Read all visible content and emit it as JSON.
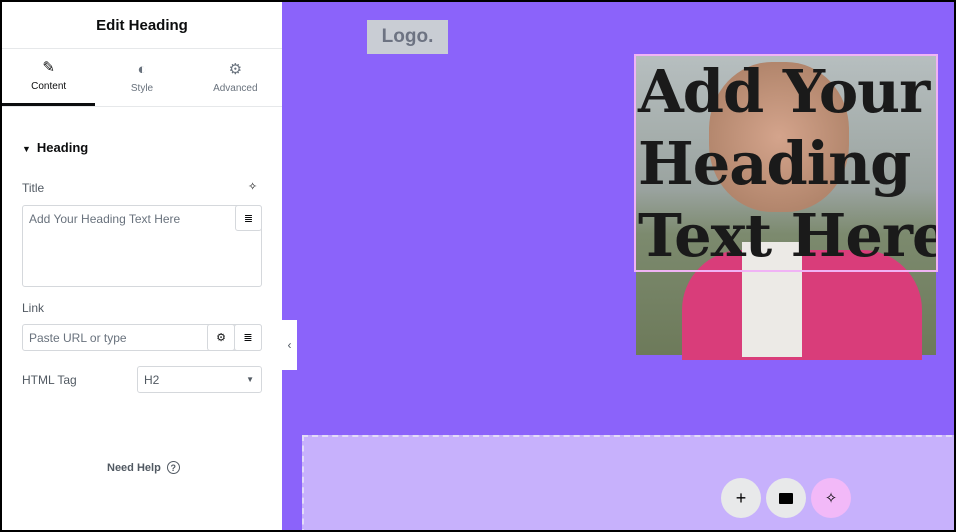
{
  "panel": {
    "title": "Edit Heading",
    "tabs": [
      {
        "label": "Content",
        "icon": "pencil-icon"
      },
      {
        "label": "Style",
        "icon": "half-circle-icon"
      },
      {
        "label": "Advanced",
        "icon": "gear-icon"
      }
    ],
    "section": "Heading",
    "title_label": "Title",
    "title_placeholder": "Add Your Heading Text Here",
    "link_label": "Link",
    "link_placeholder": "Paste URL or type",
    "html_tag_label": "HTML Tag",
    "html_tag_value": "H2",
    "help": "Need Help"
  },
  "canvas": {
    "logo": "Logo.",
    "heading": [
      "Add Your",
      "Heading",
      "Text Here"
    ],
    "background": "#8b63fa"
  }
}
